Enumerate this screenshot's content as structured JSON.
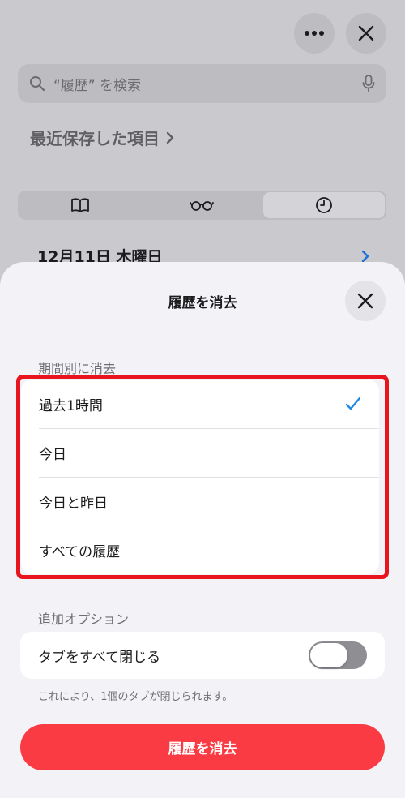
{
  "background": {
    "search_placeholder": "“履歴” を検索",
    "recent_saved_label": "最近保存した項目",
    "segments": [
      "book-icon",
      "glasses-icon",
      "clock-icon"
    ],
    "active_segment": "clock-icon",
    "date_label": "12月11日 木曜日"
  },
  "sheet": {
    "title": "履歴を消去",
    "period_section_label": "期間別に消去",
    "period_options": [
      "過去1時間",
      "今日",
      "今日と昨日",
      "すべての履歴"
    ],
    "selected_period": "過去1時間",
    "options_section_label": "追加オプション",
    "toggle_label": "タブをすべて閉じる",
    "toggle_on": false,
    "toggle_note": "これにより、1個のタブが閉じられます。",
    "clear_button_label": "履歴を消去"
  },
  "colors": {
    "accent": "#1e88e5",
    "destructive": "#fb3b44",
    "highlight": "#e8141e"
  }
}
